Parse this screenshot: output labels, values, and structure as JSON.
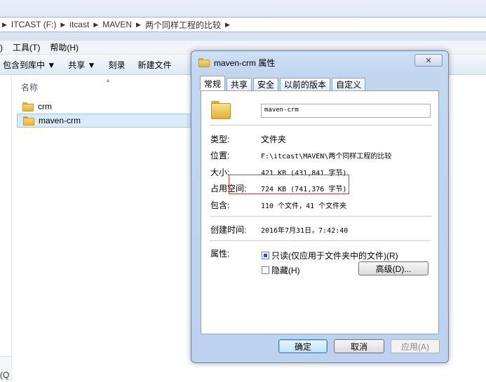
{
  "explorer": {
    "breadcrumbs": [
      "ITCAST (F:)",
      "itcast",
      "MAVEN",
      "两个同样工程的比较"
    ],
    "menu": [
      "工具(T)",
      "帮助(H)"
    ],
    "menu_left_fragment": ")",
    "toolbar": [
      "包含到库中 ▼",
      "共享 ▼",
      "刻录",
      "新建文件"
    ],
    "column_name": "名称",
    "files": [
      "crm",
      "maven-crm"
    ],
    "status_fragment": "(Q"
  },
  "dialog": {
    "title": "maven-crm 属性",
    "close_glyph": "✕",
    "tabs": [
      "常规",
      "共享",
      "安全",
      "以前的版本",
      "自定义"
    ],
    "folder_name": "maven-crm",
    "type_label": "类型:",
    "type_value": "文件夹",
    "location_label": "位置:",
    "location_value": "F:\\itcast\\MAVEN\\两个同样工程的比较",
    "size_label": "大小:",
    "size_value": "421 KB (431,841 字节)",
    "disk_label": "占用空间:",
    "disk_value": "724 KB (741,376 字节)",
    "contains_label": "包含:",
    "contains_value": "110 个文件，41 个文件夹",
    "created_label": "创建时间:",
    "created_value": "2016年7月31日，7:42:40",
    "attributes_label": "属性:",
    "readonly_label": "只读(仅应用于文件夹中的文件)(R)",
    "hidden_label": "隐藏(H)",
    "advanced_button": "高级(D)...",
    "ok_button": "确定",
    "cancel_button": "取消",
    "apply_button": "应用(A)"
  },
  "colors": {
    "highlight_box": "#e0403a",
    "checkbox_fill": "#1f5fbf"
  }
}
